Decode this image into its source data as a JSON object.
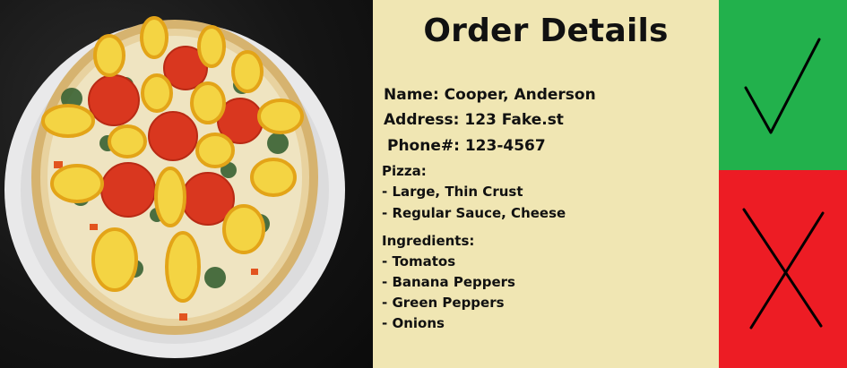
{
  "order": {
    "title": "Order Details",
    "name_line": "Name: Cooper, Anderson",
    "address_line": "Address: 123 Fake.st",
    "phone_line": "Phone#: 123-4567",
    "pizza_header": "Pizza:",
    "pizza_items": [
      "- Large, Thin Crust",
      "- Regular Sauce, Cheese"
    ],
    "ingredients_header": "Ingredients:",
    "ingredients": [
      "- Tomatos",
      "- Banana Peppers",
      "- Green Peppers",
      "- Onions"
    ]
  },
  "actions": {
    "accept_icon": "checkmark-icon",
    "reject_icon": "x-icon",
    "accept_color": "#22b14c",
    "reject_color": "#ed1c24"
  },
  "colors": {
    "panel_bg": "#f0e6b3",
    "text": "#111111"
  }
}
